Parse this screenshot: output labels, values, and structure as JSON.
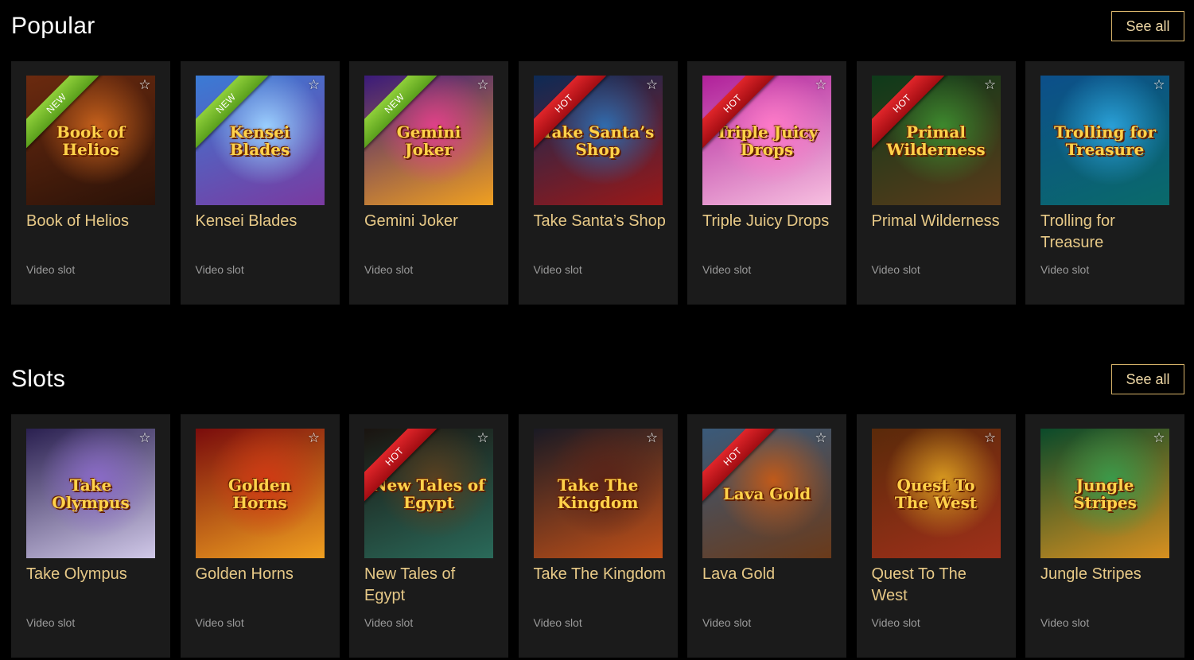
{
  "sections": [
    {
      "title": "Popular",
      "see_all": "See all",
      "games": [
        {
          "name": "Book of Helios",
          "type": "Video slot",
          "badge": "NEW",
          "badge_kind": "new",
          "art_text": "Book of Helios",
          "colors": [
            "#6b2a0f",
            "#c8621c",
            "#2a1208"
          ]
        },
        {
          "name": "Kensei Blades",
          "type": "Video slot",
          "badge": "NEW",
          "badge_kind": "new",
          "art_text": "Kensei Blades",
          "colors": [
            "#3a7bd5",
            "#9ad0ff",
            "#7a3aa0"
          ]
        },
        {
          "name": "Gemini Joker",
          "type": "Video slot",
          "badge": "NEW",
          "badge_kind": "new",
          "art_text": "Gemini Joker",
          "colors": [
            "#3a1a7a",
            "#e0408a",
            "#f0a020"
          ]
        },
        {
          "name": "Take Santa’s Shop",
          "type": "Video slot",
          "badge": "HOT",
          "badge_kind": "hot",
          "art_text": "Take Santa’s Shop",
          "colors": [
            "#0d2a55",
            "#2f6db0",
            "#9a1818"
          ]
        },
        {
          "name": "Triple Juicy Drops",
          "type": "Video slot",
          "badge": "HOT",
          "badge_kind": "hot",
          "art_text": "Triple Juicy Drops",
          "colors": [
            "#b0209a",
            "#ff7ac8",
            "#f7c0e0"
          ]
        },
        {
          "name": "Primal Wilderness",
          "type": "Video slot",
          "badge": "HOT",
          "badge_kind": "hot",
          "art_text": "Primal Wilderness",
          "colors": [
            "#0e3a1a",
            "#3d8a2e",
            "#5a3a1a"
          ]
        },
        {
          "name": "Trolling for Treasure",
          "type": "Video slot",
          "badge": "",
          "badge_kind": "",
          "art_text": "Trolling for Treasure",
          "colors": [
            "#0c4f8a",
            "#2aa0d8",
            "#0a6a6a"
          ]
        }
      ]
    },
    {
      "title": "Slots",
      "see_all": "See all",
      "games": [
        {
          "name": "Take Olympus",
          "type": "Video slot",
          "badge": "",
          "badge_kind": "",
          "art_text": "Take Olympus",
          "colors": [
            "#2a2050",
            "#8a6ac8",
            "#d0c8e8"
          ]
        },
        {
          "name": "Golden Horns",
          "type": "Video slot",
          "badge": "",
          "badge_kind": "",
          "art_text": "Golden Horns",
          "colors": [
            "#7a0c0c",
            "#d03a14",
            "#f0a020"
          ]
        },
        {
          "name": "New Tales of Egypt",
          "type": "Video slot",
          "badge": "HOT",
          "badge_kind": "hot",
          "art_text": "New Tales of Egypt",
          "colors": [
            "#1a1410",
            "#5a4020",
            "#2a6a5a"
          ]
        },
        {
          "name": "Take The Kingdom",
          "type": "Video slot",
          "badge": "",
          "badge_kind": "",
          "art_text": "Take The Kingdom",
          "colors": [
            "#1a1a24",
            "#5a2418",
            "#c05018"
          ]
        },
        {
          "name": "Lava Gold",
          "type": "Video slot",
          "badge": "HOT",
          "badge_kind": "hot",
          "art_text": "Lava Gold",
          "colors": [
            "#3a5a7a",
            "#c05a1a",
            "#6a3a1a"
          ]
        },
        {
          "name": "Quest To The West",
          "type": "Video slot",
          "badge": "",
          "badge_kind": "",
          "art_text": "Quest To The West",
          "colors": [
            "#5a2a0a",
            "#d89a20",
            "#a0301a"
          ]
        },
        {
          "name": "Jungle Stripes",
          "type": "Video slot",
          "badge": "",
          "badge_kind": "",
          "art_text": "Jungle Stripes",
          "colors": [
            "#0a4a2a",
            "#3a9a4a",
            "#d89020"
          ]
        }
      ]
    }
  ],
  "icons": {
    "favorite": "star-outline-icon"
  }
}
